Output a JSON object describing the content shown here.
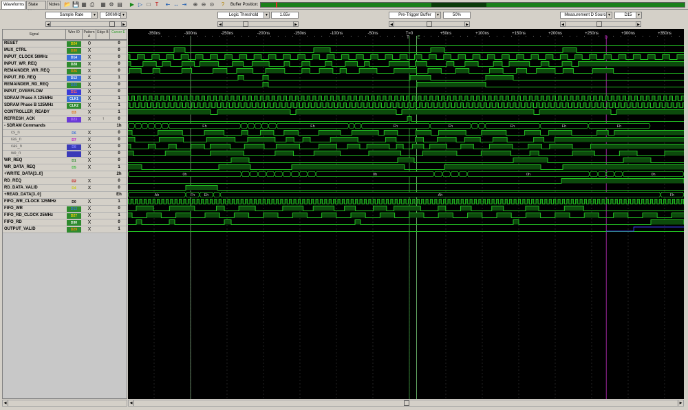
{
  "tabs": [
    {
      "label": "Waveforms",
      "active": true
    },
    {
      "label": "State List",
      "active": false
    },
    {
      "label": "Notes",
      "active": false
    }
  ],
  "buffer_position_label": "Buffer Position:",
  "buffer_position_fraction": 0.6,
  "controls": [
    {
      "label": "Sample Rate",
      "value": "500MHz"
    },
    {
      "label": "Logic Threshold",
      "value": "1.65v"
    },
    {
      "label": "Pre-Trigger Buffer",
      "value": "50%"
    },
    {
      "label": "Measurement D Source",
      "value": "D15"
    }
  ],
  "columns": {
    "signal": "Signal",
    "wire_id": "Wire ID",
    "pattern": "Pattern A",
    "edge": "Edge B",
    "cursor": "Cursor E"
  },
  "time_axis": {
    "labels": [
      "-350ns",
      "-300ns",
      "-250ns",
      "-200ns",
      "-150ns",
      "-100ns",
      "-50ns",
      "T=0",
      "+50ns",
      "+100ns",
      "+150ns",
      "+200ns",
      "+250ns",
      "+300ns",
      "+350ns"
    ],
    "trigger_marker": "T",
    "cursor_e_marker": "E",
    "cursor_d_marker": "D"
  },
  "signals": [
    {
      "name": "RESET",
      "wire": "D24",
      "wire_color": "#2e8b2e",
      "wire_text": "#ffd700",
      "pattern": "0",
      "edge": "",
      "cursor": "0",
      "sub": false
    },
    {
      "name": "MUX_CTRL",
      "wire": "D30",
      "wire_color": "#2e8b2e",
      "wire_text": "#ff8c00",
      "pattern": "X",
      "edge": "",
      "cursor": "0",
      "sub": false
    },
    {
      "name": "INPUT_CLOCK 50MHz",
      "wire": "D14",
      "wire_color": "#3a6fd8",
      "wire_text": "#ffffff",
      "pattern": "X",
      "edge": "",
      "cursor": "0",
      "sub": false
    },
    {
      "name": "INPUT_WR_REQ",
      "wire": "D28",
      "wire_color": "#2e8b2e",
      "wire_text": "#ffffff",
      "pattern": "X",
      "edge": "",
      "cursor": "0",
      "sub": false
    },
    {
      "name": "REMAINDER_WR_REQ",
      "wire": "D26",
      "wire_color": "#2e8b2e",
      "wire_text": "#ff8c00",
      "pattern": "X",
      "edge": "",
      "cursor": "0",
      "sub": false
    },
    {
      "name": "INPUT_RD_REQ",
      "wire": "D12",
      "wire_color": "#3a6fd8",
      "wire_text": "#ffffff",
      "pattern": "X",
      "edge": "",
      "cursor": "1",
      "sub": false
    },
    {
      "name": "REMAINDER_RD_REQ",
      "wire": "D25",
      "wire_color": "#2e8b2e",
      "wire_text": "#3a6fd8",
      "pattern": "X",
      "edge": "",
      "cursor": "0",
      "sub": false
    },
    {
      "name": "INPUT_OVERFLOW",
      "wire": "D11",
      "wire_color": "#3a3ad8",
      "wire_text": "#ff6666",
      "pattern": "X",
      "edge": "",
      "cursor": "0",
      "sub": false
    },
    {
      "name": "SDRAM Phase A 125MHz",
      "wire": "CLK1",
      "wire_color": "#3a6fd8",
      "wire_text": "#ffffff",
      "pattern": "X",
      "edge": "",
      "cursor": "1",
      "sub": false
    },
    {
      "name": "SDRAM Phase B 125MHz",
      "wire": "CLK2",
      "wire_color": "#2e8b2e",
      "wire_text": "#ffffff",
      "pattern": "X",
      "edge": "",
      "cursor": "1",
      "sub": false
    },
    {
      "name": "CONTROLLER_READY",
      "wire": "D3",
      "wire_color": "#d4d0c8",
      "wire_text": "#e06000",
      "pattern": "X",
      "edge": "",
      "cursor": "1",
      "sub": false
    },
    {
      "name": "REFRESH_ACK",
      "wire": "D23",
      "wire_color": "#6a3ad8",
      "wire_text": "#c080ff",
      "pattern": "X",
      "edge": "↑",
      "cursor": "0",
      "sub": false
    },
    {
      "name": "- SDRAM Commands",
      "wire": "",
      "wire_color": "#d4d0c8",
      "wire_text": "#000000",
      "pattern": "",
      "edge": "",
      "cursor": "1h",
      "sub": false
    },
    {
      "name": "cs_n",
      "wire": "D6",
      "wire_color": "#d4d0c8",
      "wire_text": "#3a6fd8",
      "pattern": "X",
      "edge": "",
      "cursor": "0",
      "sub": true
    },
    {
      "name": "ras_n",
      "wire": "D7",
      "wire_color": "#d4d0c8",
      "wire_text": "#c000c0",
      "pattern": "X",
      "edge": "",
      "cursor": "0",
      "sub": true
    },
    {
      "name": "cas_n",
      "wire": "D8",
      "wire_color": "#3a3ab8",
      "wire_text": "#8080ff",
      "pattern": "X",
      "edge": "",
      "cursor": "0",
      "sub": true
    },
    {
      "name": "we_n",
      "wire": "D9",
      "wire_color": "#3a3ab8",
      "wire_text": "#3a3ab8",
      "pattern": "X",
      "edge": "",
      "cursor": "0",
      "sub": true
    },
    {
      "name": "WR_REQ",
      "wire": "D1",
      "wire_color": "#d4d0c8",
      "wire_text": "#2e8b2e",
      "pattern": "X",
      "edge": "",
      "cursor": "0",
      "sub": false
    },
    {
      "name": "WR_DATA_REQ",
      "wire": "D5",
      "wire_color": "#d4d0c8",
      "wire_text": "#2eb82e",
      "pattern": "X",
      "edge": "",
      "cursor": "1",
      "sub": false
    },
    {
      "name": "+WRITE_DATA[3..0]",
      "wire": "",
      "wire_color": "#d4d0c8",
      "wire_text": "#000000",
      "pattern": "",
      "edge": "",
      "cursor": "2h",
      "sub": false
    },
    {
      "name": "RD_REQ",
      "wire": "D2",
      "wire_color": "#d4d0c8",
      "wire_text": "#c00000",
      "pattern": "X",
      "edge": "",
      "cursor": "0",
      "sub": false
    },
    {
      "name": "RD_DATA_VALID",
      "wire": "D4",
      "wire_color": "#d4d0c8",
      "wire_text": "#c8c800",
      "pattern": "X",
      "edge": "",
      "cursor": "0",
      "sub": false
    },
    {
      "name": "+READ_DATA[3..0]",
      "wire": "",
      "wire_color": "#d4d0c8",
      "wire_text": "#000000",
      "pattern": "",
      "edge": "",
      "cursor": "Eh",
      "sub": false
    },
    {
      "name": "FIFO_WR_CLOCK 125MHz",
      "wire": "D0",
      "wire_color": "#d4d0c8",
      "wire_text": "#000000",
      "pattern": "X",
      "edge": "",
      "cursor": "1",
      "sub": false
    },
    {
      "name": "FIFO_WR",
      "wire": "D13",
      "wire_color": "#2e8b2e",
      "wire_text": "#3a6fd8",
      "pattern": "X",
      "edge": "",
      "cursor": "0",
      "sub": false
    },
    {
      "name": "FIFO_RD_CLOCK 25MHz",
      "wire": "D27",
      "wire_color": "#2e8b2e",
      "wire_text": "#ffd700",
      "pattern": "X",
      "edge": "",
      "cursor": "1",
      "sub": false
    },
    {
      "name": "FIFO_RD",
      "wire": "D30",
      "wire_color": "#2e8b2e",
      "wire_text": "#ffffff",
      "pattern": "X",
      "edge": "",
      "cursor": "0",
      "sub": false
    },
    {
      "name": "OUTPUT_VALID",
      "wire": "D29",
      "wire_color": "#2e8b2e",
      "wire_text": "#ff8c00",
      "pattern": "X",
      "edge": "",
      "cursor": "1",
      "sub": false
    }
  ],
  "bus_values": {
    "sdram_cmd": [
      "Ph",
      "8h",
      "8h",
      "8h",
      "8h",
      "8h",
      "Fh",
      "Fh",
      "4h",
      "4h",
      "8h",
      "8h",
      "Fh",
      "Fh",
      "Fh",
      "Fh",
      "Fh",
      "8h",
      "Fh",
      "Fh",
      "Fh",
      "Fh"
    ],
    "write_data": [
      "0h",
      "8h",
      "6h",
      "0h",
      "0h"
    ],
    "read_data": [
      "Ah",
      "Fh",
      "Eh",
      "Fh"
    ]
  },
  "colors": {
    "wave": "#22c022",
    "wave_fill": "#0c4a0c",
    "cursor_e": "#7ad07a",
    "cursor_d": "#c030c0",
    "trigger": "#40a040",
    "grid": "#3a3a3a"
  }
}
